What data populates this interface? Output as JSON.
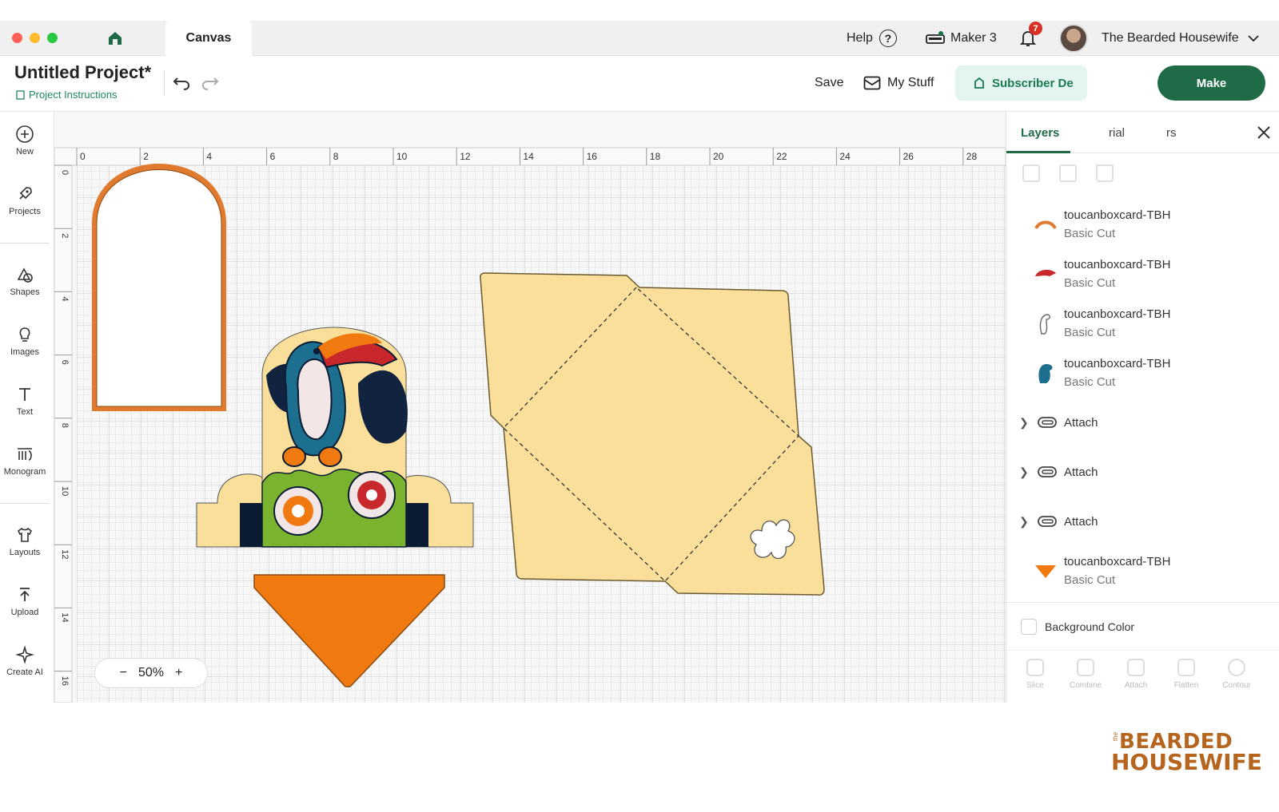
{
  "titlebar": {
    "tab_label": "Canvas",
    "help_label": "Help",
    "help_glyph": "?",
    "machine_label": "Maker 3",
    "notification_count": "7",
    "user_name": "The Bearded Housewife"
  },
  "header": {
    "project_title": "Untitled Project*",
    "project_instructions": "Project Instructions",
    "save_label": "Save",
    "my_stuff_label": "My Stuff",
    "subscriber_label": "Subscriber De",
    "make_label": "Make"
  },
  "sidebar": {
    "items": [
      {
        "label": "New",
        "icon": "plus-circle-icon"
      },
      {
        "label": "Projects",
        "icon": "rocket-icon"
      },
      {
        "label": "Shapes",
        "icon": "shapes-icon"
      },
      {
        "label": "Images",
        "icon": "lightbulb-icon"
      },
      {
        "label": "Text",
        "icon": "text-icon"
      },
      {
        "label": "Monogram",
        "icon": "monogram-icon"
      },
      {
        "label": "Layouts",
        "icon": "shirt-icon"
      },
      {
        "label": "Upload",
        "icon": "upload-icon"
      },
      {
        "label": "Create AI",
        "icon": "sparkle-icon"
      }
    ]
  },
  "canvas": {
    "ruler_top": [
      "0",
      "2",
      "4",
      "6",
      "8",
      "10",
      "12",
      "14",
      "16",
      "18",
      "20",
      "22",
      "24",
      "26",
      "28"
    ],
    "ruler_left": [
      "0",
      "2",
      "4",
      "6",
      "8",
      "10",
      "12",
      "14",
      "16"
    ],
    "zoom_minus": "−",
    "zoom_value": "50%",
    "zoom_plus": "+"
  },
  "panel": {
    "tabs": [
      "Layers",
      "rial",
      "rs"
    ],
    "layers": [
      {
        "name": "toucanboxcard-TBH",
        "op": "Basic Cut",
        "color": "#e07a2e"
      },
      {
        "name": "toucanboxcard-TBH",
        "op": "Basic Cut",
        "color": "#c8282b"
      },
      {
        "name": "toucanboxcard-TBH",
        "op": "Basic Cut",
        "color": "#ffffff"
      },
      {
        "name": "toucanboxcard-TBH",
        "op": "Basic Cut",
        "color": "#1c6f8f"
      }
    ],
    "groups": [
      "Attach",
      "Attach",
      "Attach"
    ],
    "last_layer": {
      "name": "toucanboxcard-TBH",
      "op": "Basic Cut",
      "color": "#f07a10"
    },
    "background_label": "Background Color",
    "bottom_tools": [
      "Slice",
      "Combine",
      "Attach",
      "Flatten",
      "Contour"
    ]
  },
  "logo": {
    "line_the": "the",
    "line1": "BEARDED",
    "line2": "HOUSEWIFE"
  },
  "colors": {
    "brand_green": "#1f6b47",
    "annotation_arrow": "#8a5a12",
    "envelope_fill": "#f9df9a",
    "triangle_orange": "#f07a10",
    "arch_orange": "#e07a2e"
  }
}
